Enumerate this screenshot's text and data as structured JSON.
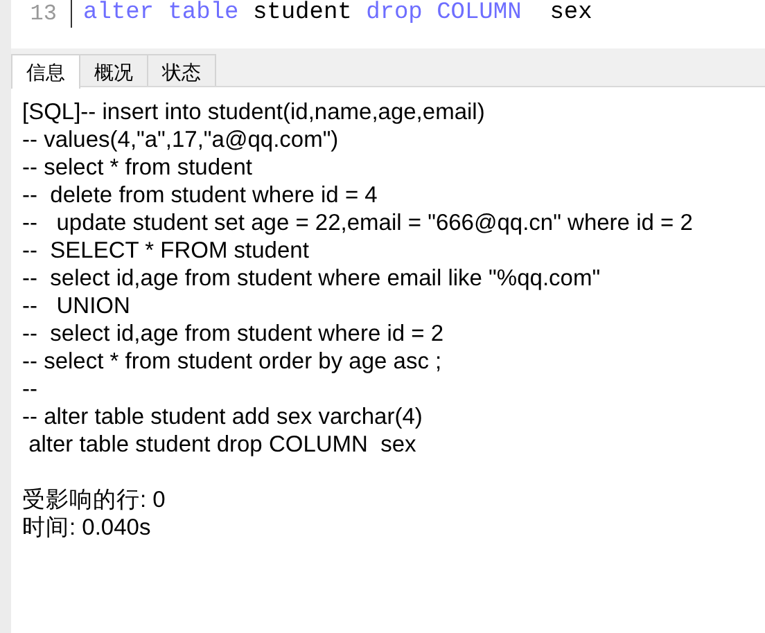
{
  "editor": {
    "line_number": "13",
    "tokens": [
      {
        "text": "alter ",
        "kind": "keyword"
      },
      {
        "text": "table ",
        "kind": "keyword"
      },
      {
        "text": "student ",
        "kind": "plain"
      },
      {
        "text": "drop ",
        "kind": "keyword"
      },
      {
        "text": "COLUMN  ",
        "kind": "keyword"
      },
      {
        "text": "sex",
        "kind": "plain"
      }
    ]
  },
  "tabs": [
    {
      "label": "信息",
      "selected": true
    },
    {
      "label": "概况",
      "selected": false
    },
    {
      "label": "状态",
      "selected": false
    }
  ],
  "message_lines": [
    "[SQL]-- insert into student(id,name,age,email)",
    "-- values(4,\"a\",17,\"a@qq.com\")",
    "-- select * from student",
    "--  delete from student where id = 4",
    "--   update student set age = 22,email = \"666@qq.cn\" where id = 2",
    "--  SELECT * FROM student",
    "--  select id,age from student where email like \"%qq.com\"",
    "--   UNION",
    "--  select id,age from student where id = 2",
    "-- select * from student order by age asc ;",
    "--",
    "-- alter table student add sex varchar(4)",
    " alter table student drop COLUMN  sex"
  ],
  "result_lines": [
    "受影响的行: 0",
    "时间: 0.040s"
  ]
}
